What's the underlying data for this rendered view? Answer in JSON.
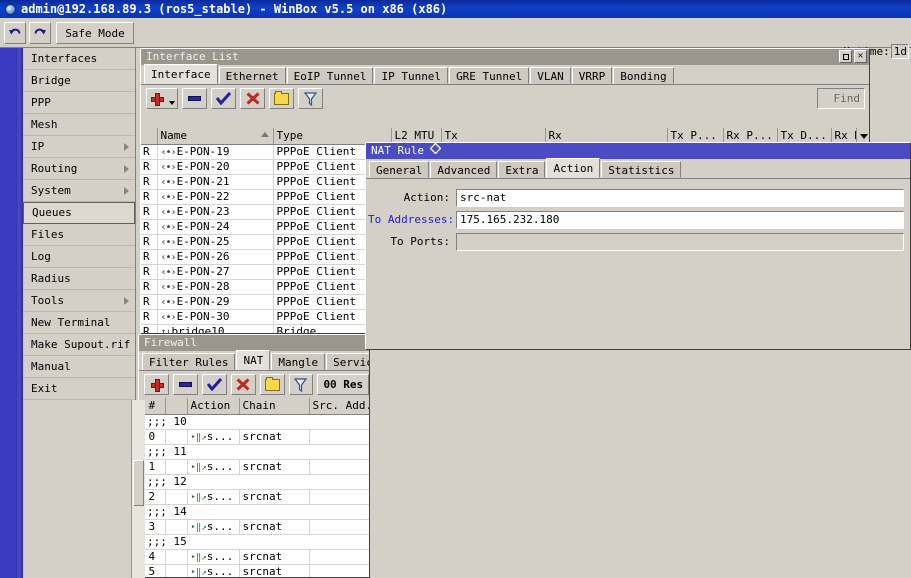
{
  "app": {
    "title": "admin@192.168.89.3 (ros5_stable) - WinBox v5.5 on x86 (x86)",
    "icon": "globe-icon"
  },
  "toolbar": {
    "undo_icon": "undo-arrow-icon",
    "redo_icon": "redo-arrow-icon",
    "safe_mode_label": "Safe Mode",
    "uptime_label": "Uptime:",
    "uptime_value": "1d"
  },
  "sidebar": {
    "items": [
      {
        "label": "Interfaces",
        "submenu": false,
        "selected": false
      },
      {
        "label": "Bridge",
        "submenu": false,
        "selected": false
      },
      {
        "label": "PPP",
        "submenu": false,
        "selected": false
      },
      {
        "label": "Mesh",
        "submenu": false,
        "selected": false
      },
      {
        "label": "IP",
        "submenu": true,
        "selected": false
      },
      {
        "label": "Routing",
        "submenu": true,
        "selected": false
      },
      {
        "label": "System",
        "submenu": true,
        "selected": false
      },
      {
        "label": "Queues",
        "submenu": false,
        "selected": true
      },
      {
        "label": "Files",
        "submenu": false,
        "selected": false
      },
      {
        "label": "Log",
        "submenu": false,
        "selected": false
      },
      {
        "label": "Radius",
        "submenu": false,
        "selected": false
      },
      {
        "label": "Tools",
        "submenu": true,
        "selected": false
      },
      {
        "label": "New Terminal",
        "submenu": false,
        "selected": false
      },
      {
        "label": "Make Supout.rif",
        "submenu": false,
        "selected": false
      },
      {
        "label": "Manual",
        "submenu": false,
        "selected": false
      },
      {
        "label": "Exit",
        "submenu": false,
        "selected": false
      }
    ]
  },
  "interface_window": {
    "title": "Interface List",
    "active": false,
    "buttons": {
      "maximize": "maximize-icon",
      "close": "close-icon"
    },
    "tabs": [
      {
        "label": "Interface",
        "active": true
      },
      {
        "label": "Ethernet",
        "active": false
      },
      {
        "label": "EoIP Tunnel",
        "active": false
      },
      {
        "label": "IP Tunnel",
        "active": false
      },
      {
        "label": "GRE Tunnel",
        "active": false
      },
      {
        "label": "VLAN",
        "active": false
      },
      {
        "label": "VRRP",
        "active": false
      },
      {
        "label": "Bonding",
        "active": false
      }
    ],
    "toolbar": {
      "add_icon": "add-plus-icon",
      "remove_icon": "remove-minus-icon",
      "enable_icon": "enable-check-icon",
      "disable_icon": "disable-cross-icon",
      "comment_icon": "comment-folder-icon",
      "filter_icon": "filter-funnel-icon",
      "find_placeholder": "Find"
    },
    "columns": [
      "",
      "Name",
      "Type",
      "L2 MTU",
      "Tx",
      "Rx",
      "Tx P...",
      "Rx P...",
      "Tx D...",
      "Rx D."
    ],
    "rows": [
      {
        "flag": "R",
        "name": "E-PON-19",
        "type": "PPPoE Client"
      },
      {
        "flag": "R",
        "name": "E-PON-20",
        "type": "PPPoE Client"
      },
      {
        "flag": "R",
        "name": "E-PON-21",
        "type": "PPPoE Client"
      },
      {
        "flag": "R",
        "name": "E-PON-22",
        "type": "PPPoE Client"
      },
      {
        "flag": "R",
        "name": "E-PON-23",
        "type": "PPPoE Client"
      },
      {
        "flag": "R",
        "name": "E-PON-24",
        "type": "PPPoE Client"
      },
      {
        "flag": "R",
        "name": "E-PON-25",
        "type": "PPPoE Client"
      },
      {
        "flag": "R",
        "name": "E-PON-26",
        "type": "PPPoE Client"
      },
      {
        "flag": "R",
        "name": "E-PON-27",
        "type": "PPPoE Client"
      },
      {
        "flag": "R",
        "name": "E-PON-28",
        "type": "PPPoE Client"
      },
      {
        "flag": "R",
        "name": "E-PON-29",
        "type": "PPPoE Client"
      },
      {
        "flag": "R",
        "name": "E-PON-30",
        "type": "PPPoE Client"
      },
      {
        "flag": "R",
        "name": "bridge10",
        "type": "Bridge"
      }
    ]
  },
  "nat_rule_window": {
    "title": "NAT Rule",
    "title_marker": "diamond-icon",
    "active": true,
    "tabs": [
      {
        "label": "General",
        "active": false
      },
      {
        "label": "Advanced",
        "active": false
      },
      {
        "label": "Extra",
        "active": false
      },
      {
        "label": "Action",
        "active": true
      },
      {
        "label": "Statistics",
        "active": false
      }
    ],
    "fields": [
      {
        "label": "Action:",
        "value": "src-nat",
        "label_color": "black",
        "disabled": false
      },
      {
        "label": "To Addresses:",
        "value": "175.165.232.180",
        "label_color": "blue",
        "disabled": false
      },
      {
        "label": "To Ports:",
        "value": "",
        "label_color": "black",
        "disabled": true
      }
    ]
  },
  "firewall_window": {
    "title": "Firewall",
    "active": false,
    "tabs": [
      {
        "label": "Filter Rules",
        "active": false
      },
      {
        "label": "NAT",
        "active": true
      },
      {
        "label": "Mangle",
        "active": false
      },
      {
        "label": "Service P",
        "active": false
      }
    ],
    "toolbar": {
      "add_icon": "add-plus-icon",
      "remove_icon": "remove-minus-icon",
      "enable_icon": "enable-check-icon",
      "disable_icon": "disable-cross-icon",
      "comment_icon": "comment-folder-icon",
      "filter_icon": "filter-funnel-icon",
      "reset_label": "00 Res"
    },
    "columns": [
      "#",
      "",
      "Action",
      "Chain",
      "Src. Add."
    ],
    "rows": [
      {
        "kind": "comment",
        "text": ";;; 10"
      },
      {
        "kind": "rule",
        "num": "0",
        "action": "s...",
        "chain": "srcnat",
        "src": ""
      },
      {
        "kind": "comment",
        "text": ";;; 11"
      },
      {
        "kind": "rule",
        "num": "1",
        "action": "s...",
        "chain": "srcnat",
        "src": ""
      },
      {
        "kind": "comment",
        "text": ";;; 12"
      },
      {
        "kind": "rule",
        "num": "2",
        "action": "s...",
        "chain": "srcnat",
        "src": ""
      },
      {
        "kind": "comment",
        "text": ";;; 14"
      },
      {
        "kind": "rule",
        "num": "3",
        "action": "s...",
        "chain": "srcnat",
        "src": ""
      },
      {
        "kind": "comment",
        "text": ";;; 15"
      },
      {
        "kind": "rule",
        "num": "4",
        "action": "s...",
        "chain": "srcnat",
        "src": ""
      },
      {
        "kind": "rule",
        "num": "5",
        "action": "s...",
        "chain": "srcnat",
        "src": ""
      }
    ]
  },
  "colors": {
    "titlebar_blue": "#1040c8",
    "window_active_title": "#4b4bc4",
    "window_inactive_title": "#9a968e",
    "face": "#d4d0c8",
    "rail": "#3b3bbf",
    "label_blue": "#2020c8"
  }
}
